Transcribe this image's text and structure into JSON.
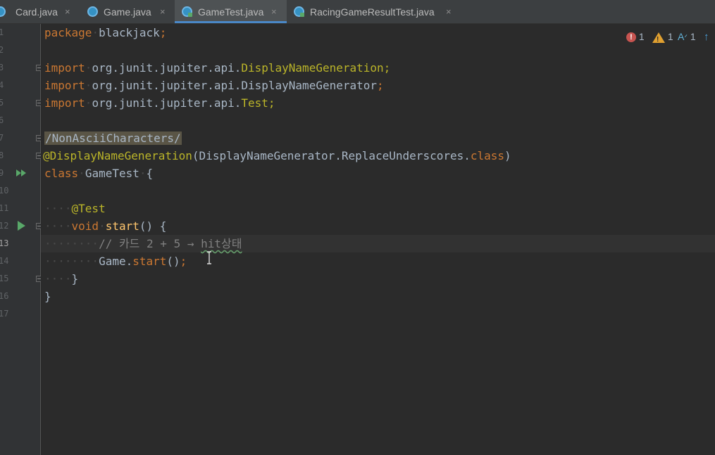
{
  "tabs": [
    {
      "label": "Card.java",
      "close": "×",
      "icon": "java-class-icon"
    },
    {
      "label": "Game.java",
      "close": "×",
      "icon": "java-class-icon"
    },
    {
      "label": "GameTest.java",
      "close": "×",
      "icon": "java-test-class-icon"
    },
    {
      "label": "RacingGameResultTest.java",
      "close": "×",
      "icon": "java-test-class-icon"
    }
  ],
  "active_tab_index": 2,
  "gutter": {
    "line_numbers": [
      "1",
      "2",
      "3",
      "4",
      "5",
      "6",
      "7",
      "8",
      "9",
      "10",
      "11",
      "12",
      "13",
      "14",
      "15",
      "16",
      "17"
    ],
    "current_line": "13"
  },
  "code": {
    "l1": {
      "kw": "package",
      "name": "blackjack",
      "semi": ";"
    },
    "l3": {
      "kw": "import",
      "pkg": "org.junit.jupiter.api.",
      "cls": "DisplayNameGeneration",
      "semi": ";"
    },
    "l4": {
      "kw": "import",
      "pkg": "org.junit.jupiter.api.DisplayNameGenerator",
      "semi": ";"
    },
    "l5": {
      "kw": "import",
      "pkg": "org.junit.jupiter.api.",
      "cls": "Test",
      "semi": ";"
    },
    "l7": {
      "text": "/NonAsciiCharacters/"
    },
    "l8": {
      "ann": "@DisplayNameGeneration",
      "open": "(DisplayNameGenerator.ReplaceUnderscores.",
      "kw": "class",
      "close": ")"
    },
    "l9": {
      "kw": "class",
      "name": "GameTest",
      "brace": "{"
    },
    "l11": {
      "ann": "@Test"
    },
    "l12": {
      "kw": "void",
      "fn": "start",
      "rest": "() {"
    },
    "l13": {
      "comment": "// 카드 2 + 5 → ",
      "typo": "hit상태"
    },
    "l14": {
      "obj": "Game.",
      "fn": "start",
      "rest": "()",
      "semi": ";"
    },
    "l15": {
      "brace": "}"
    },
    "l16": {
      "brace": "}"
    }
  },
  "inspections": {
    "errors": "1",
    "warnings": "1",
    "typos": "1"
  },
  "colors": {
    "background": "#2b2b2b",
    "keyword": "#cc7832",
    "annotation": "#bbb529",
    "function": "#ffc66d",
    "comment": "#808080",
    "active_tab_underline": "#4a88c7"
  }
}
